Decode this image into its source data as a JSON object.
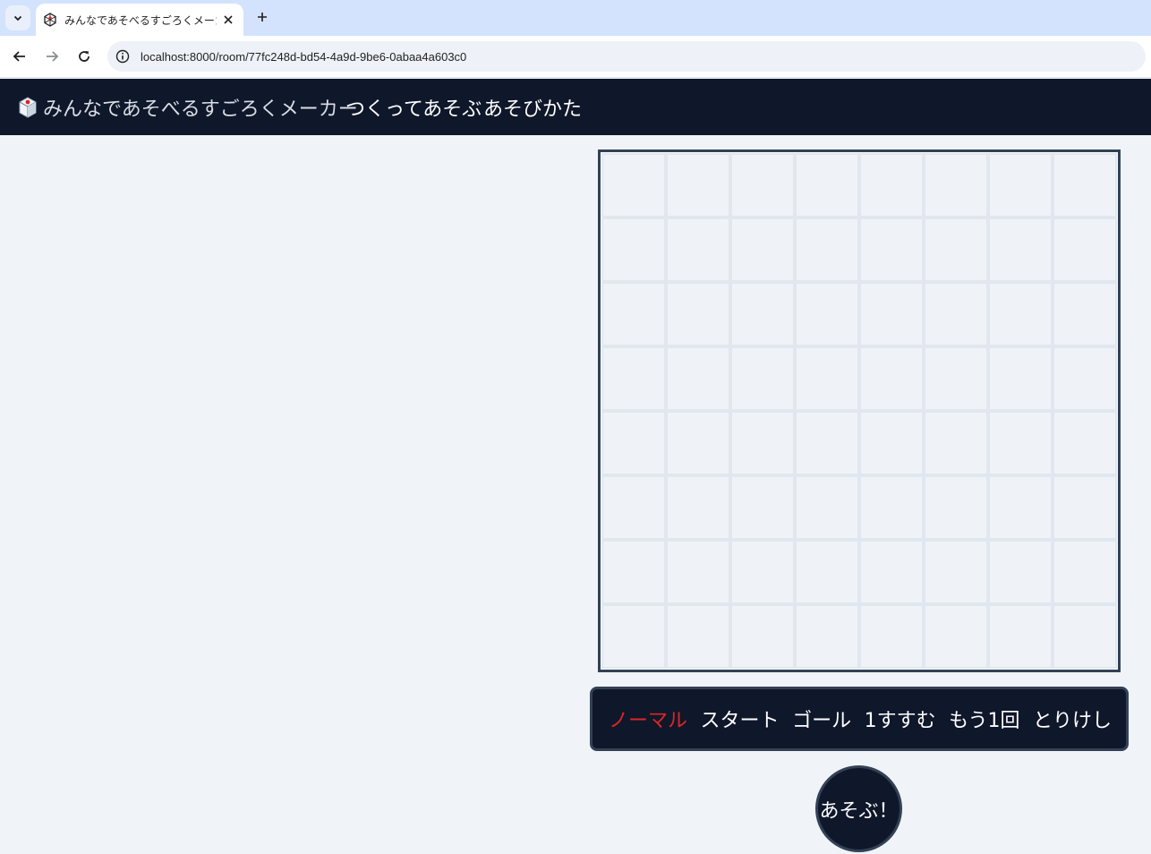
{
  "browser": {
    "tab_title": "みんなであそべるすごろくメーカー",
    "url": "localhost:8000/room/77fc248d-bd54-4a9d-9be6-0abaa4a603c0"
  },
  "navbar": {
    "brand": "みんなであそべるすごろくメーカー",
    "links": [
      "つくってあそぶ",
      "あそびかた"
    ]
  },
  "board": {
    "rows": 8,
    "cols": 8
  },
  "palette": {
    "tools": [
      "ノーマル",
      "スタート",
      "ゴール",
      "1すすむ",
      "もう1回",
      "とりけし"
    ],
    "selected": "ノーマル"
  },
  "play_button": "あそぶ！",
  "colors": {
    "navbar_bg": "#0f172a",
    "border": "#334155",
    "active_tool": "#dc2626",
    "page_bg": "#f0f4f9"
  }
}
